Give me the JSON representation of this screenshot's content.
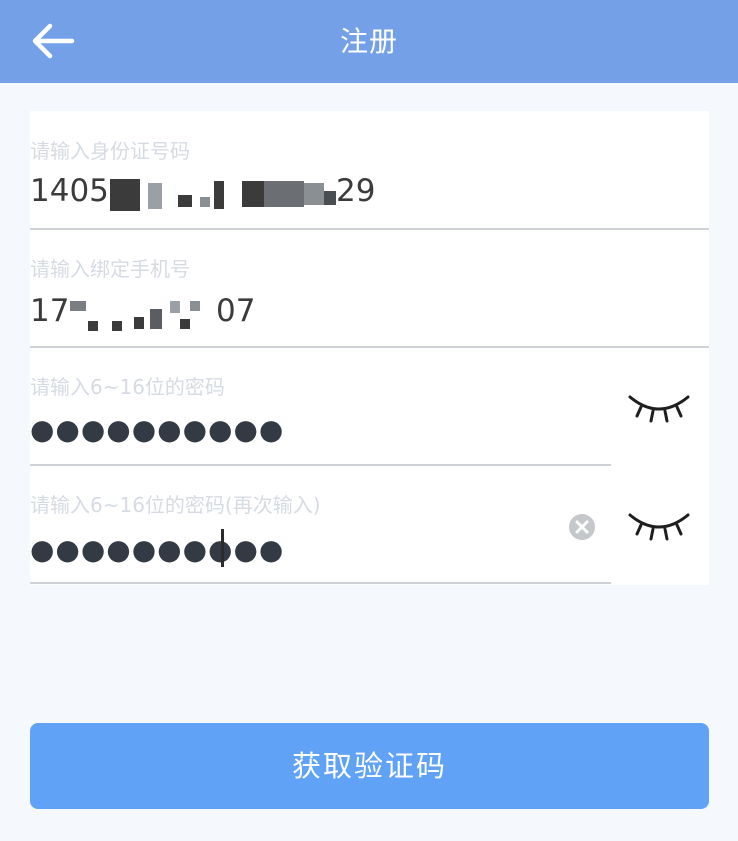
{
  "header": {
    "title": "注册",
    "back_icon": "arrow-left-icon"
  },
  "form": {
    "id_field": {
      "placeholder": "请输入身份证号码",
      "value_start": "1405",
      "value_end": "29"
    },
    "phone_field": {
      "placeholder": "请输入绑定手机号",
      "value_start": "17",
      "value_end": "07"
    },
    "password_field": {
      "placeholder": "请输入6~16位的密码",
      "value": "●●●●●●●●●●"
    },
    "confirm_field": {
      "placeholder": "请输入6~16位的密码(再次输入)",
      "value": "●●●●●●●●●●"
    }
  },
  "actions": {
    "get_code_label": "获取验证码"
  },
  "icons": {
    "eye": "eye-closed-icon",
    "clear": "clear-circle-icon"
  },
  "colors": {
    "header": "#74a0e8",
    "button": "#5fa2f6",
    "background": "#f5f8fc"
  }
}
